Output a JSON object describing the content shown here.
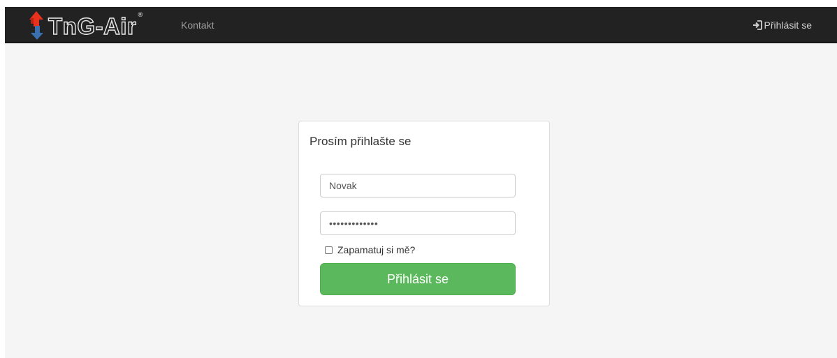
{
  "navbar": {
    "brand_name": "TnG-Air",
    "brand_reg_mark": "®",
    "brand_icon": "red-blue-arrows-logo",
    "links": [
      {
        "label": "Kontakt"
      }
    ],
    "login_link": {
      "label": "Přihlásit se",
      "icon": "sign-in-icon"
    }
  },
  "login_panel": {
    "title": "Prosím přihlašte se",
    "username": {
      "value": "Novak"
    },
    "password": {
      "value": "•••••••••••••"
    },
    "remember_me": {
      "label": "Zapamatuj si mě?",
      "checked": false
    },
    "submit_label": "Přihlásit se"
  },
  "colors": {
    "navbar_bg": "#222222",
    "page_bg": "#f5f5f5",
    "button_green": "#5cb85c",
    "brand_red": "#e8321e",
    "brand_blue": "#3a6fb0"
  }
}
